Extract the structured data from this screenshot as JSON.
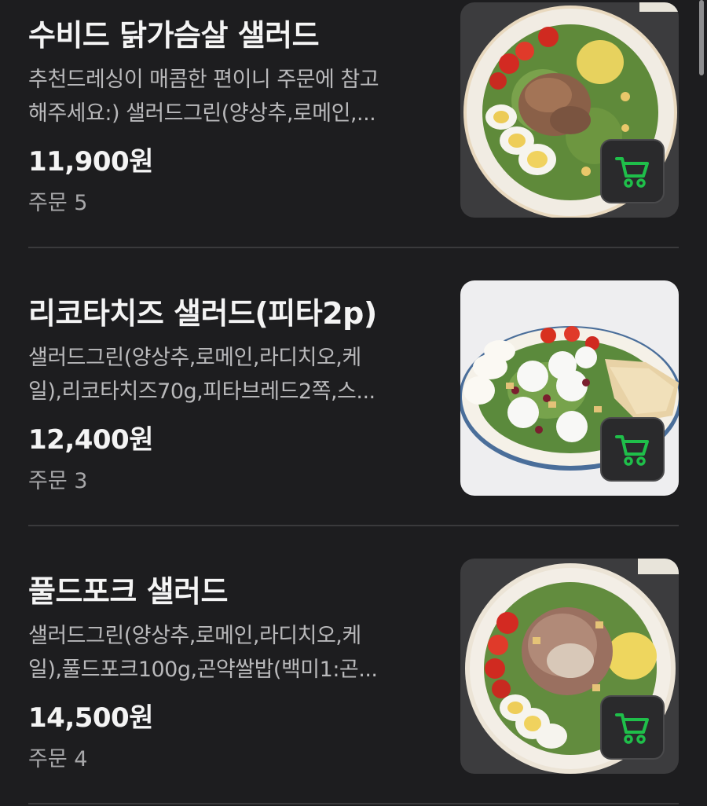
{
  "items": [
    {
      "title": "수비드 닭가슴살 샐러드",
      "desc": "추천드레싱이 매콤한 편이니 주문에 참고\n해주세요:) 샐러드그린(양상추,로메인,...",
      "price": "11,900원",
      "orders": "주문 5",
      "image": "chicken-salad-photo",
      "accent": "#1fbf4a"
    },
    {
      "title": "리코타치즈 샐러드(피타2p)",
      "desc": "샐러드그린(양상추,로메인,라디치오,케\n일),리코타치즈70g,피타브레드2쪽,스...",
      "price": "12,400원",
      "orders": "주문 3",
      "image": "ricotta-salad-photo",
      "accent": "#1fbf4a"
    },
    {
      "title": "풀드포크 샐러드",
      "desc": "샐러드그린(양상추,로메인,라디치오,케\n일),풀드포크100g,곤약쌀밥(백미1:곤...",
      "price": "14,500원",
      "orders": "주문 4",
      "image": "pulled-pork-salad-photo",
      "accent": "#1fbf4a"
    }
  ]
}
